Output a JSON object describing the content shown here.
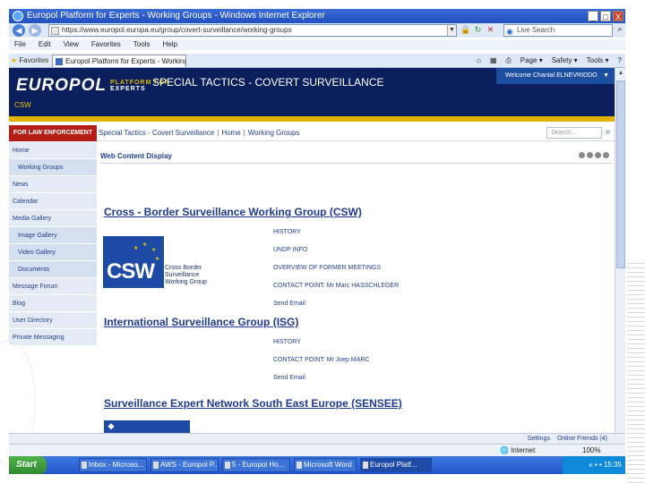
{
  "window": {
    "title": "Europol Platform for Experts - Working Groups - Windows Internet Explorer",
    "controls": [
      "_",
      "□",
      "X"
    ]
  },
  "browser": {
    "address": "https://www.europol.europa.eu/group/covert-surveillance/working-groups",
    "search_placeholder": "Live Search",
    "menu": [
      "File",
      "Edit",
      "View",
      "Favorites",
      "Tools",
      "Help"
    ],
    "favorites_label": "Favorites",
    "tab_label": "Europol Platform for Experts - Working Groups",
    "command_bar": [
      "Page ▾",
      "Safety ▾",
      "Tools ▾",
      "?"
    ]
  },
  "header": {
    "logo_main": "EUROPOL",
    "logo_sub_top": "PLATFORM FOR",
    "logo_sub_bottom": "EXPERTS",
    "site_title": "SPECIAL TACTICS - COVERT SURVEILLANCE",
    "welcome": "Welcome Chantal ELNEVRIDDO",
    "community": "CSW"
  },
  "subnav": {
    "le_button": "FOR LAW ENFORCEMENT",
    "crumbs": [
      "Special Tactics - Covert Surveillance",
      "Home",
      "Working Groups"
    ],
    "search_placeholder": "Search..."
  },
  "sidebar": {
    "items": [
      {
        "label": "Home",
        "sub": false
      },
      {
        "label": "Working Groups",
        "sub": true
      },
      {
        "label": "News",
        "sub": false
      },
      {
        "label": "Calendar",
        "sub": false
      },
      {
        "label": "Media Gallery",
        "sub": false
      },
      {
        "label": "Image Gallery",
        "sub": true
      },
      {
        "label": "Video Gallery",
        "sub": true
      },
      {
        "label": "Documents",
        "sub": true
      },
      {
        "label": "Message Forum",
        "sub": false
      },
      {
        "label": "Blog",
        "sub": false
      },
      {
        "label": "User Directory",
        "sub": false
      },
      {
        "label": "Private Messaging",
        "sub": false
      }
    ]
  },
  "main": {
    "portlet_title": "Web Content Display",
    "groups": [
      {
        "title": "Cross - Border Surveillance Working Group (CSW)",
        "links": [
          "HISTORY",
          "UNDP INFO",
          "OVERVIEW OF FORMER MEETINGS",
          "CONTACT POINT: Mr Marc HASSCHLEGER",
          "Send Email"
        ],
        "logo_text": "CSW",
        "caption": [
          "Cross Border",
          "Surveillance",
          "Working Group"
        ]
      },
      {
        "title": "International Surveillance Group (ISG)",
        "links": [
          "HISTORY",
          "CONTACT POINT: Mr Joep MARC",
          "Send Email"
        ]
      },
      {
        "title": "Surveillance Expert Network South East Europe (SENSEE)",
        "links": []
      }
    ]
  },
  "status": {
    "links": [
      "Settings",
      "Online Friends (4)"
    ],
    "zone": "Internet",
    "zoom": "100%"
  },
  "taskbar": {
    "start": "Start",
    "items": [
      "Inbox - Microso...",
      "AWS - Europol P...",
      "5 - Europol Ho...",
      "Microsoft Word",
      "Europol Platf..."
    ],
    "clock": "15:35"
  }
}
